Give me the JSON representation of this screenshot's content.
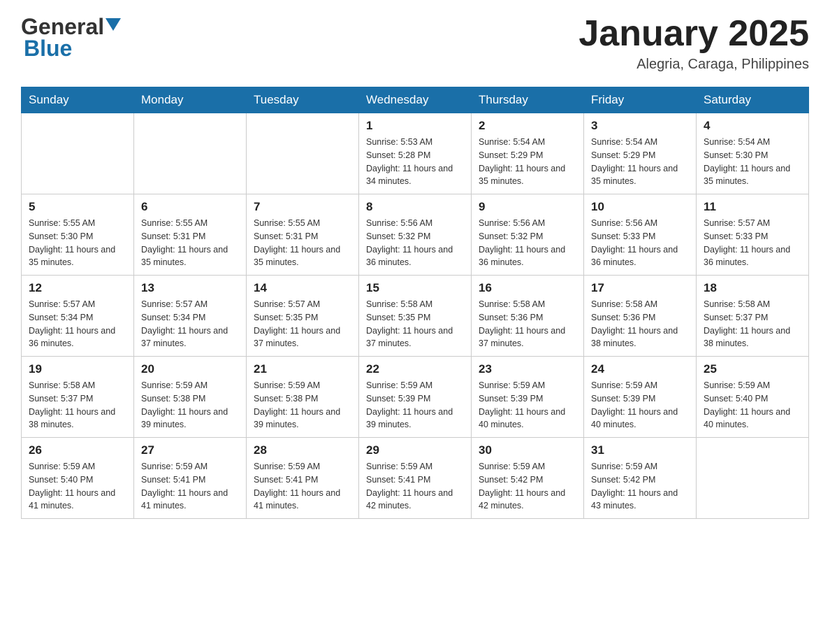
{
  "header": {
    "title": "January 2025",
    "subtitle": "Alegria, Caraga, Philippines"
  },
  "days_of_week": [
    "Sunday",
    "Monday",
    "Tuesday",
    "Wednesday",
    "Thursday",
    "Friday",
    "Saturday"
  ],
  "weeks": [
    [
      {
        "day": "",
        "info": ""
      },
      {
        "day": "",
        "info": ""
      },
      {
        "day": "",
        "info": ""
      },
      {
        "day": "1",
        "info": "Sunrise: 5:53 AM\nSunset: 5:28 PM\nDaylight: 11 hours\nand 34 minutes."
      },
      {
        "day": "2",
        "info": "Sunrise: 5:54 AM\nSunset: 5:29 PM\nDaylight: 11 hours\nand 35 minutes."
      },
      {
        "day": "3",
        "info": "Sunrise: 5:54 AM\nSunset: 5:29 PM\nDaylight: 11 hours\nand 35 minutes."
      },
      {
        "day": "4",
        "info": "Sunrise: 5:54 AM\nSunset: 5:30 PM\nDaylight: 11 hours\nand 35 minutes."
      }
    ],
    [
      {
        "day": "5",
        "info": "Sunrise: 5:55 AM\nSunset: 5:30 PM\nDaylight: 11 hours\nand 35 minutes."
      },
      {
        "day": "6",
        "info": "Sunrise: 5:55 AM\nSunset: 5:31 PM\nDaylight: 11 hours\nand 35 minutes."
      },
      {
        "day": "7",
        "info": "Sunrise: 5:55 AM\nSunset: 5:31 PM\nDaylight: 11 hours\nand 35 minutes."
      },
      {
        "day": "8",
        "info": "Sunrise: 5:56 AM\nSunset: 5:32 PM\nDaylight: 11 hours\nand 36 minutes."
      },
      {
        "day": "9",
        "info": "Sunrise: 5:56 AM\nSunset: 5:32 PM\nDaylight: 11 hours\nand 36 minutes."
      },
      {
        "day": "10",
        "info": "Sunrise: 5:56 AM\nSunset: 5:33 PM\nDaylight: 11 hours\nand 36 minutes."
      },
      {
        "day": "11",
        "info": "Sunrise: 5:57 AM\nSunset: 5:33 PM\nDaylight: 11 hours\nand 36 minutes."
      }
    ],
    [
      {
        "day": "12",
        "info": "Sunrise: 5:57 AM\nSunset: 5:34 PM\nDaylight: 11 hours\nand 36 minutes."
      },
      {
        "day": "13",
        "info": "Sunrise: 5:57 AM\nSunset: 5:34 PM\nDaylight: 11 hours\nand 37 minutes."
      },
      {
        "day": "14",
        "info": "Sunrise: 5:57 AM\nSunset: 5:35 PM\nDaylight: 11 hours\nand 37 minutes."
      },
      {
        "day": "15",
        "info": "Sunrise: 5:58 AM\nSunset: 5:35 PM\nDaylight: 11 hours\nand 37 minutes."
      },
      {
        "day": "16",
        "info": "Sunrise: 5:58 AM\nSunset: 5:36 PM\nDaylight: 11 hours\nand 37 minutes."
      },
      {
        "day": "17",
        "info": "Sunrise: 5:58 AM\nSunset: 5:36 PM\nDaylight: 11 hours\nand 38 minutes."
      },
      {
        "day": "18",
        "info": "Sunrise: 5:58 AM\nSunset: 5:37 PM\nDaylight: 11 hours\nand 38 minutes."
      }
    ],
    [
      {
        "day": "19",
        "info": "Sunrise: 5:58 AM\nSunset: 5:37 PM\nDaylight: 11 hours\nand 38 minutes."
      },
      {
        "day": "20",
        "info": "Sunrise: 5:59 AM\nSunset: 5:38 PM\nDaylight: 11 hours\nand 39 minutes."
      },
      {
        "day": "21",
        "info": "Sunrise: 5:59 AM\nSunset: 5:38 PM\nDaylight: 11 hours\nand 39 minutes."
      },
      {
        "day": "22",
        "info": "Sunrise: 5:59 AM\nSunset: 5:39 PM\nDaylight: 11 hours\nand 39 minutes."
      },
      {
        "day": "23",
        "info": "Sunrise: 5:59 AM\nSunset: 5:39 PM\nDaylight: 11 hours\nand 40 minutes."
      },
      {
        "day": "24",
        "info": "Sunrise: 5:59 AM\nSunset: 5:39 PM\nDaylight: 11 hours\nand 40 minutes."
      },
      {
        "day": "25",
        "info": "Sunrise: 5:59 AM\nSunset: 5:40 PM\nDaylight: 11 hours\nand 40 minutes."
      }
    ],
    [
      {
        "day": "26",
        "info": "Sunrise: 5:59 AM\nSunset: 5:40 PM\nDaylight: 11 hours\nand 41 minutes."
      },
      {
        "day": "27",
        "info": "Sunrise: 5:59 AM\nSunset: 5:41 PM\nDaylight: 11 hours\nand 41 minutes."
      },
      {
        "day": "28",
        "info": "Sunrise: 5:59 AM\nSunset: 5:41 PM\nDaylight: 11 hours\nand 41 minutes."
      },
      {
        "day": "29",
        "info": "Sunrise: 5:59 AM\nSunset: 5:41 PM\nDaylight: 11 hours\nand 42 minutes."
      },
      {
        "day": "30",
        "info": "Sunrise: 5:59 AM\nSunset: 5:42 PM\nDaylight: 11 hours\nand 42 minutes."
      },
      {
        "day": "31",
        "info": "Sunrise: 5:59 AM\nSunset: 5:42 PM\nDaylight: 11 hours\nand 43 minutes."
      },
      {
        "day": "",
        "info": ""
      }
    ]
  ]
}
